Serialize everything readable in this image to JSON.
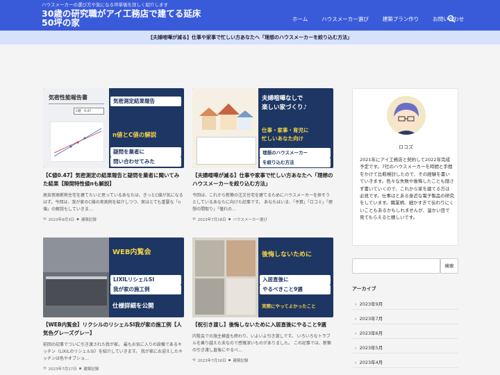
{
  "header": {
    "tagline": "ハウスメーカーの選び方や気になる坪単価を詳しく紹介します",
    "site_title": "30歳の研究職がアイ工務店で建てる延床50坪の家",
    "nav": [
      "ホーム",
      "ハウスメーカー選び",
      "建築プラン作り",
      "お問い合わせ"
    ],
    "search_icon": "search-icon"
  },
  "notice": "【夫婦喧嘩が減る】仕事や家事で忙しい方あなたへ「理想のハウスメーカーを絞り込む方法」",
  "cards": [
    {
      "thumb_left": "気密性能報告書",
      "thumb_lines": [
        "気密測定結果報告",
        "n値とC値の解説",
        "疑問を業者に",
        "問い合わせてみた"
      ],
      "thumb_c_value": "C値　0.47",
      "title": "【C値0.47】気密測定の結果報告と疑問を業者に聞いてみた結果【隙間特性値nも解説】",
      "excerpt": "高気密高断熱住宅を建てたいと思っているあなたは、きっとC値が気になるはず。今回は、我が家のC値の実測例を紹介しつつ、実はとても重要な「n値」の解説もしていきま…",
      "date": "2023年9月3日",
      "category": "建築記録"
    },
    {
      "thumb_lines": [
        "夫婦喧嘩なしで",
        "楽しい家づくり♪",
        "仕事・家事・育児に",
        "忙しいあなた向け",
        "理想のハウスメーカー",
        "を絞り込む方法"
      ],
      "title": "【夫婦喧嘩が減る】仕事や家事で忙しい方あなたへ「理想のハウスメーカーを絞り込む方法」",
      "excerpt": "今回は、これから新築の注文住宅を建てるためにハウスメーカーを探そうとしているあなたに向けた記事です。 あなたはいま、「予算」「ロコミ」「理想の間取り」「憧れの…",
      "date": "2023年7月18日",
      "category": "ハウスメーカー選び"
    },
    {
      "thumb_lines": [
        "WEB内覧会",
        "LIXILリシェルSI",
        "我が家の施工例",
        "仕様詳細を公開"
      ],
      "title": "【WEB内覧会】リクシルのリシェルSI我が家の施工例【人気色グレーズグレー】",
      "excerpt": "前回の記事でついに引き渡された我が家。 最もお気に入りの設備であるキッチン（LIXILのリシェルSI）を紹介していきます。 我が家にお迎えしたキッチンは色やオプショ…",
      "date": "2023年7月17日",
      "category": "建築記録"
    },
    {
      "thumb_lines": [
        "後悔しないために",
        "入居直後に",
        "やるべきこと9選",
        "実際にやってよかったこと"
      ],
      "title": "【祝引き渡し】後悔しないために入居直後にやること9選",
      "excerpt": "内覧会での施主検査も終わり、いよいよ引き渡しです。 いろいろなトラブルを乗り越えた末なので感慨深いものがありました。 この記事では、新築の引き渡し直後にやるべ…",
      "date": "2023年7月16日",
      "category": "建築記録"
    }
  ],
  "profile": {
    "name": "ロコズ",
    "text": "2021年にアイ工務店と契約して2022年完成予定です。7社のハウスメーカーを時間と手間をかけて比較検討したので、その経験を書いていきます。色々な失敗や後悔したことも隠さず書いていくので、これから家を建てる方は必見です。仕事はとある身近な電子製品の研究をしています。職業柄、細かすぎて伝わりにくいこともあるかもしれませんが、温かい目で見てもらえると嬉しいです。"
  },
  "search": {
    "placeholder": "",
    "button": "検索"
  },
  "archive": {
    "title": "アーカイブ",
    "items": [
      "2023年9月",
      "2023年7月",
      "2023年6月",
      "2023年5月",
      "2023年4月"
    ]
  },
  "colors": {
    "header": "#3a5bd9",
    "notice": "#d6e1fb",
    "thumb_navy": "#1d3663",
    "accent_yellow": "#f3d34a"
  }
}
